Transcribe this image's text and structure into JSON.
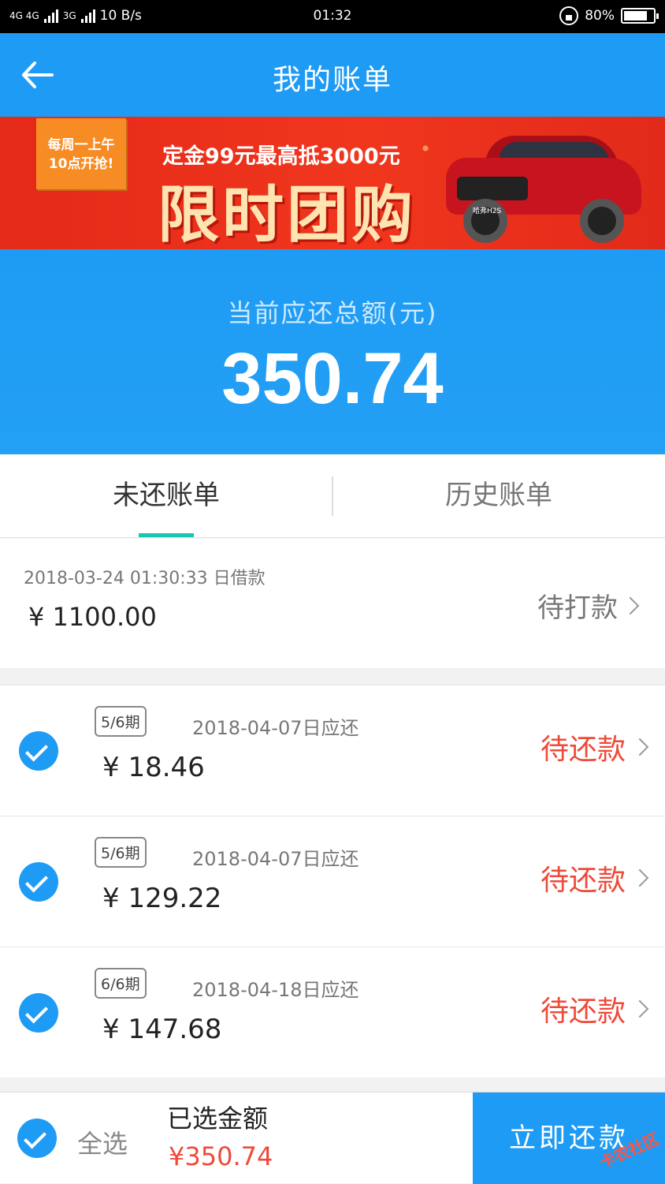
{
  "status_bar": {
    "network": "4G 4G",
    "network2": "3G",
    "speed": "10 B/s",
    "time": "01:32",
    "battery": "80%",
    "battery_level": 0.8
  },
  "app_bar": {
    "back_icon": "arrow-left-icon",
    "title": "我的账单"
  },
  "banner": {
    "tag_line1": "每周一上午",
    "tag_line2": "10点开抢!",
    "subtitle": "定金99元最高抵3000元",
    "headline": "限时团购",
    "car_badge": "哈弗H2S"
  },
  "summary": {
    "label": "当前应还总额(元)",
    "amount": "350.74"
  },
  "tabs": [
    {
      "label": "未还账单",
      "active": true
    },
    {
      "label": "历史账单",
      "active": false
    }
  ],
  "loan": {
    "date": "2018-03-24 01:30:33 日借款",
    "amount": "¥ 1100.00",
    "status": "待打款"
  },
  "bills": [
    {
      "period": "5/6期",
      "due": "2018-04-07日应还",
      "amount": "¥ 18.46",
      "status": "待还款",
      "checked": true
    },
    {
      "period": "5/6期",
      "due": "2018-04-07日应还",
      "amount": "¥ 129.22",
      "status": "待还款",
      "checked": true
    },
    {
      "period": "6/6期",
      "due": "2018-04-18日应还",
      "amount": "¥ 147.68",
      "status": "待还款",
      "checked": true
    }
  ],
  "footer": {
    "select_all": "全选",
    "selected_label": "已选金额",
    "selected_amount": "¥350.74",
    "pay_button": "立即还款",
    "watermark": "卡农社区"
  },
  "colors": {
    "primary": "#1e9bf4",
    "accent_red": "#ee4a3a",
    "tab_indicator": "#17c7b2"
  }
}
